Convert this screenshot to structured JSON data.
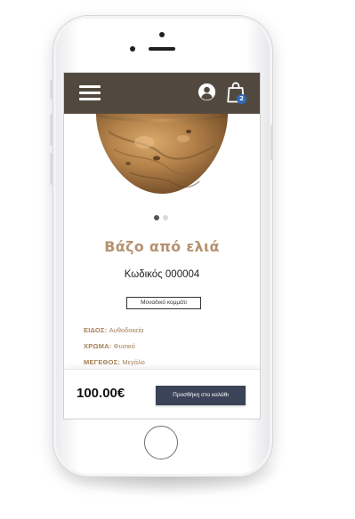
{
  "header": {
    "menu_icon": "hamburger-menu-icon",
    "user_icon": "user-account-icon",
    "cart_icon": "shopping-bag-icon",
    "cart_count": "2"
  },
  "product": {
    "image_alt": "olive wood bowl",
    "title": "Βάζο από ελιά",
    "code": "Κωδικός 000004",
    "unique_label": "Μοναδικό κομμάτι",
    "carousel": {
      "count": 2,
      "active": 1
    },
    "attributes": [
      {
        "label": "ΕΙΔΟΣ:",
        "value": "Αυθοδοκεία"
      },
      {
        "label": "ΧΡΩΜΑ:",
        "value": "Φυσικό"
      },
      {
        "label": "ΜΕΓΕΘΟΣ:",
        "value": "Μεγάλο"
      }
    ]
  },
  "footer": {
    "price": "100.00€",
    "add_to_cart_label": "Προσθήκη στο καλάθι"
  },
  "colors": {
    "header_bg": "#514940",
    "accent": "#b69170",
    "button_bg": "#3a4358",
    "badge_bg": "#2e6bb8"
  }
}
